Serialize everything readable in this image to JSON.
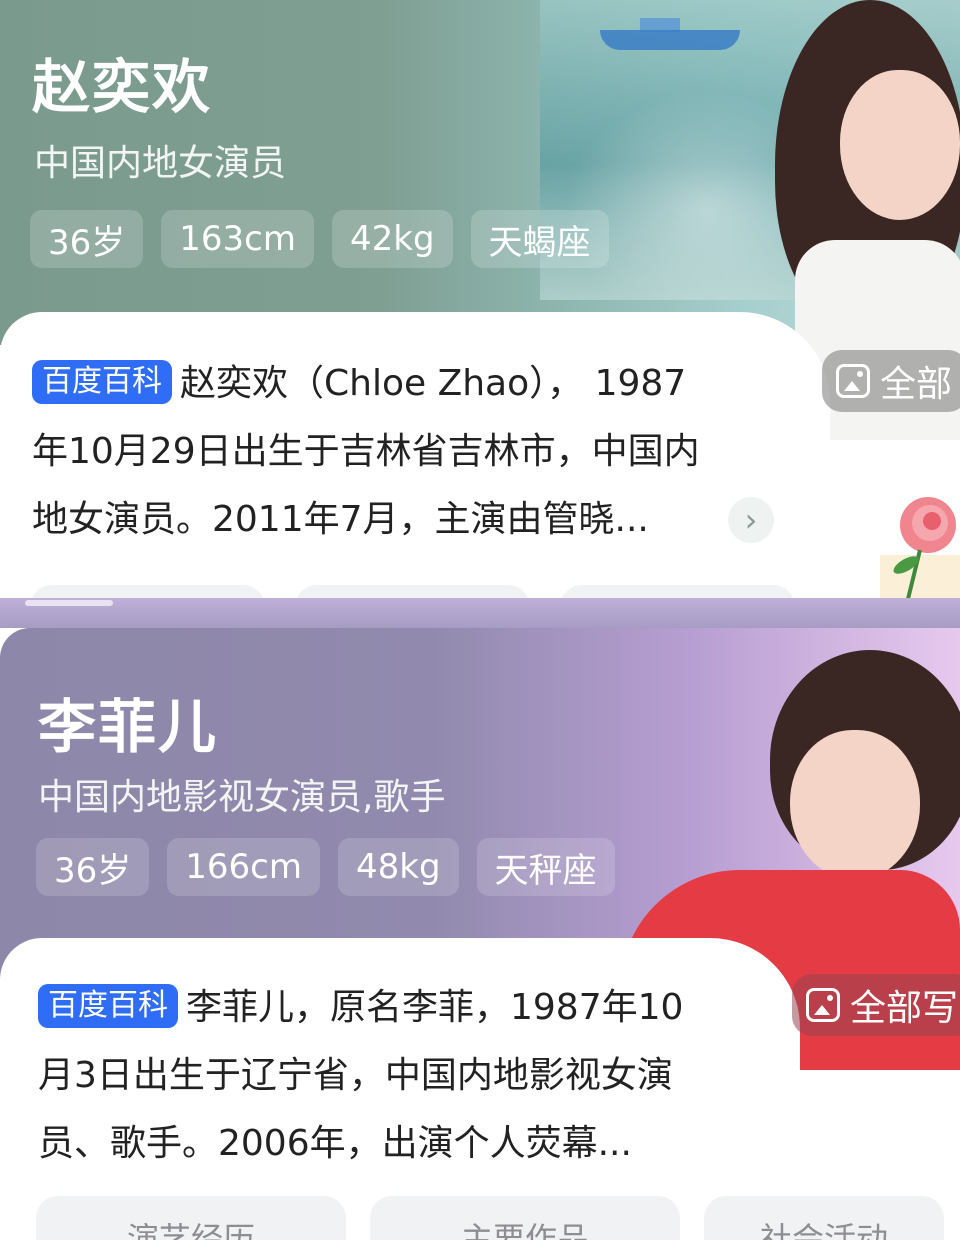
{
  "cards": [
    {
      "name": "赵奕欢",
      "subtitle": "中国内地女演员",
      "tags": [
        "36岁",
        "163cm",
        "42kg",
        "天蝎座"
      ],
      "source_badge": "百度百科",
      "description": [
        "赵奕欢（Chloe Zhao），  1987",
        "年10月29日出生于吉林省吉林市，中国内",
        "地女演员。2011年7月，主演由管晓..."
      ],
      "photos_label": "全部",
      "more_icon": "chevron-right-icon",
      "tab_labels": [
        "",
        "",
        ""
      ]
    },
    {
      "name": "李菲儿",
      "subtitle": "中国内地影视女演员,歌手",
      "tags": [
        "36岁",
        "166cm",
        "48kg",
        "天秤座"
      ],
      "source_badge": "百度百科",
      "description": [
        "李菲儿，原名李菲，1987年10",
        "月3日出生于辽宁省，中国内地影视女演",
        "员、歌手。2006年，出演个人荧幕..."
      ],
      "photos_label": "全部写",
      "tab_labels": [
        "演艺经历",
        "主要作品",
        "社会活动"
      ]
    }
  ],
  "colors": {
    "baike_badge": "#2f6df6",
    "card1_header": "#7b9a8e",
    "card2_header": "#8d87a9"
  }
}
